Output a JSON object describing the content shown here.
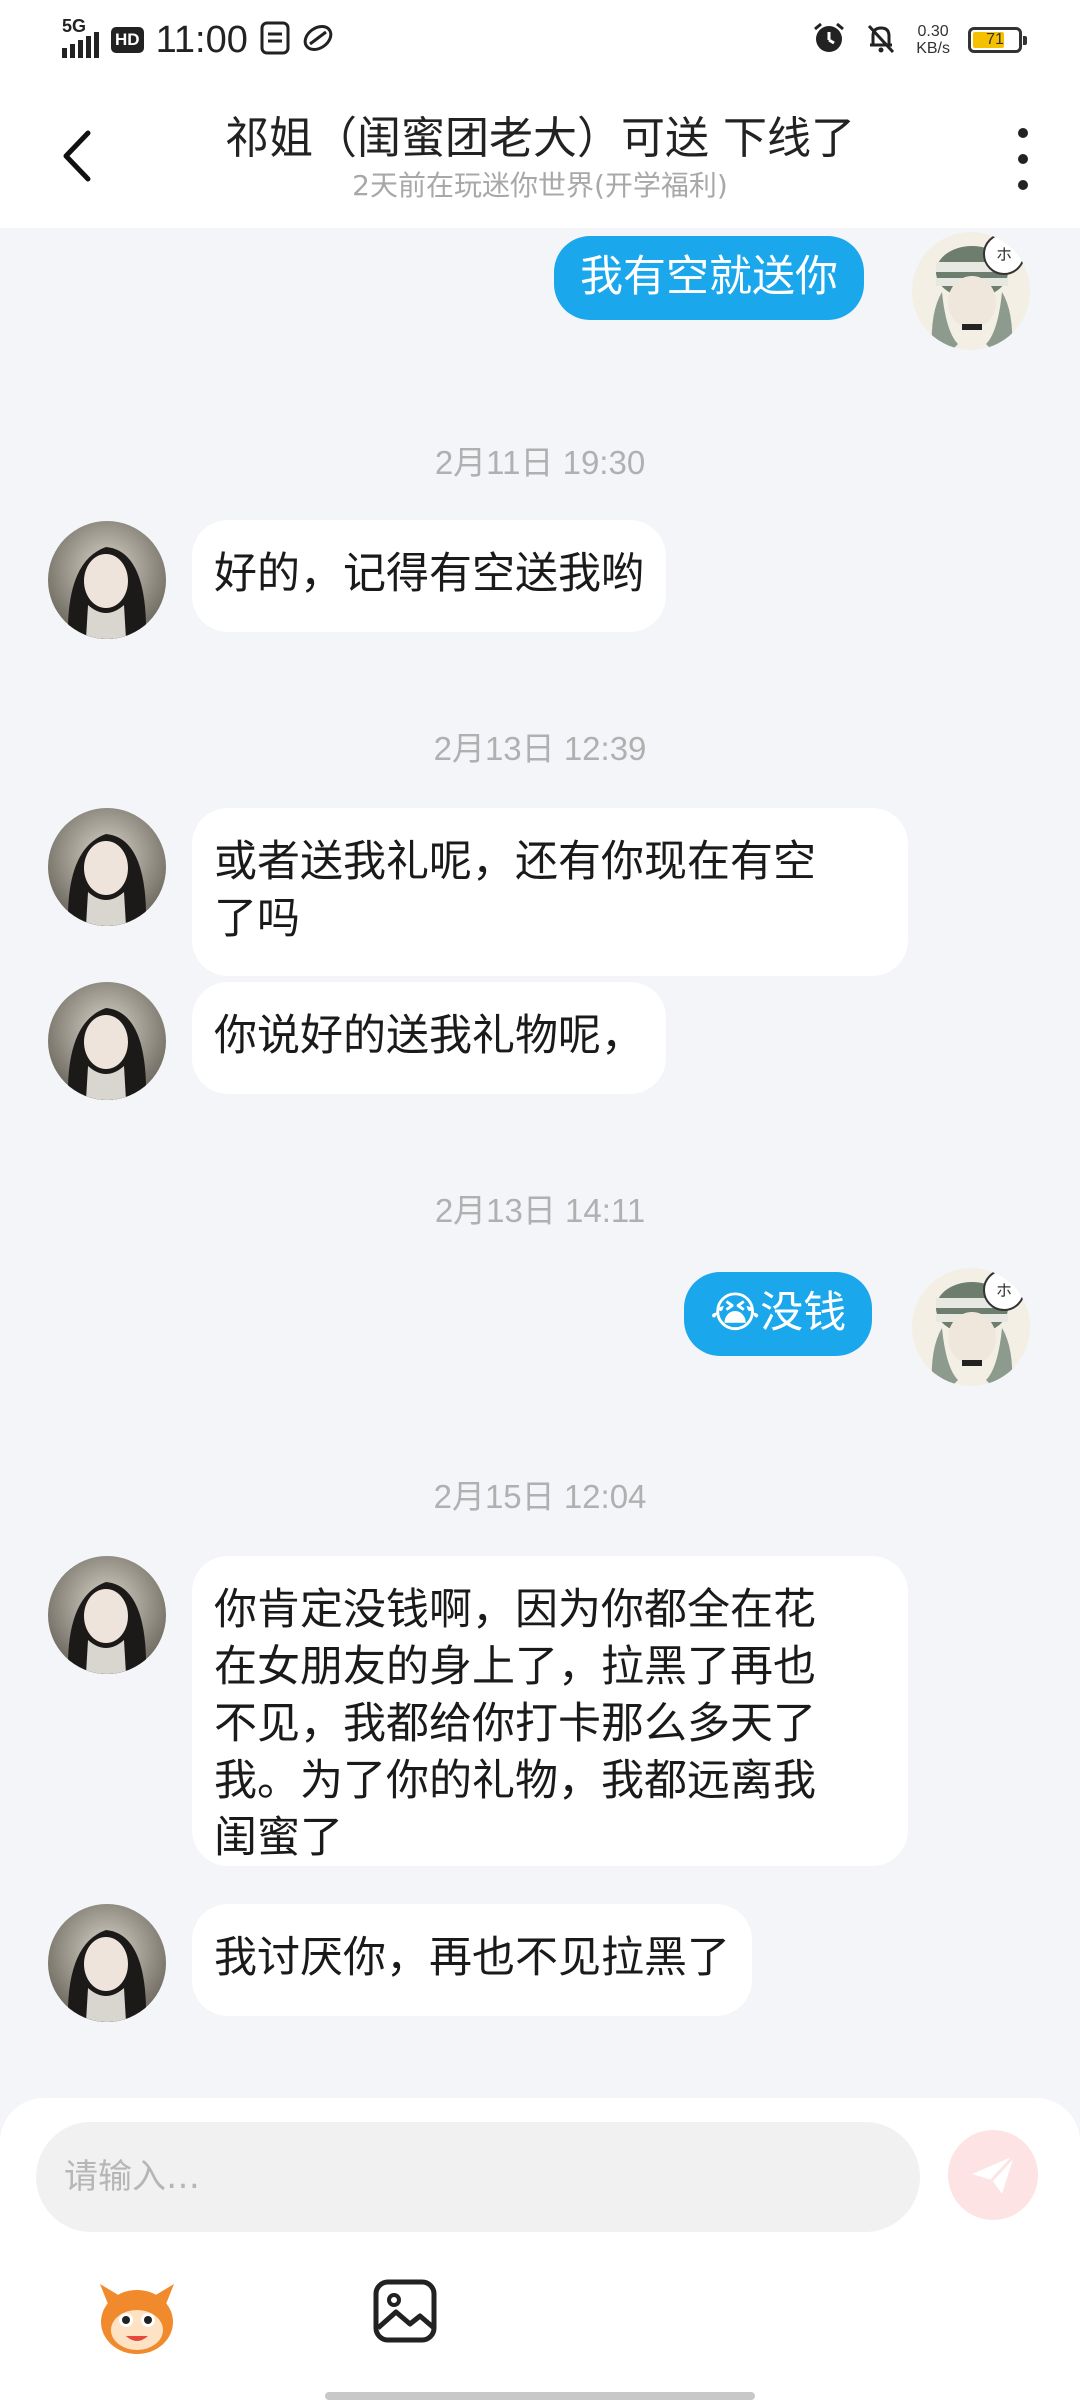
{
  "status_bar": {
    "network": "5G",
    "hd": "HD",
    "time": "11:00",
    "speed_value": "0.30",
    "speed_unit": "KB/s",
    "battery": "71",
    "battery_level": 0.71
  },
  "header": {
    "title": "祁姐（闺蜜团老大）可送 下线了",
    "subtitle": "2天前在玩迷你世界(开学福利)"
  },
  "messages": [
    {
      "type": "out",
      "text": "我有空就送你"
    },
    {
      "type": "time",
      "text": "2月11日 19:30"
    },
    {
      "type": "in",
      "text": "好的，记得有空送我哟"
    },
    {
      "type": "time",
      "text": "2月13日 12:39"
    },
    {
      "type": "in",
      "lines": [
        "或者送我礼呢，还有你现在有空",
        "了吗"
      ]
    },
    {
      "type": "in",
      "text": "你说好的送我礼物呢，"
    },
    {
      "type": "time",
      "text": "2月13日 14:11"
    },
    {
      "type": "out",
      "emoji": "😭",
      "text": "没钱"
    },
    {
      "type": "time",
      "text": "2月15日 12:04"
    },
    {
      "type": "in",
      "lines": [
        "你肯定没钱啊，因为你都全在花",
        "在女朋友的身上了，拉黑了再也",
        "不见，我都给你打卡那么多天了",
        "我。为了你的礼物，我都远离我",
        "闺蜜了"
      ]
    },
    {
      "type": "in",
      "text": "我讨厌你，再也不见拉黑了"
    }
  ],
  "input": {
    "placeholder": "请输入…"
  },
  "colors": {
    "outgoing_bubble": "#1aa7ec",
    "incoming_bubble": "#ffffff",
    "chat_background": "#f3f5f8",
    "send_button": "#fde3e3"
  },
  "icons": [
    "back-chevron-icon",
    "more-vertical-icon",
    "send-icon",
    "emoji-mascot-icon",
    "image-icon"
  ]
}
